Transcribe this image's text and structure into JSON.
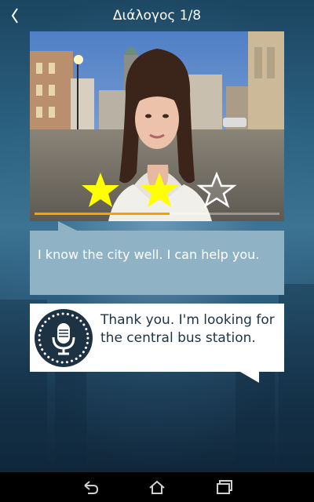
{
  "header": {
    "back_icon": "chevron-left-icon",
    "title": "Διάλογος 1/8"
  },
  "video": {
    "content": "woman-speaking-in-city-square",
    "progress_percent": 55
  },
  "rating": {
    "stars_filled": 2,
    "stars_total": 3,
    "filled_color": "#ffff00",
    "empty_color": "#ffffff"
  },
  "dialogue": {
    "speaker_line": "I know the city well. I can help you.",
    "user_line": "Thank you. I'm looking for the central bus station.",
    "mic_icon": "microphone-icon"
  },
  "nav": {
    "back_icon": "nav-back-icon",
    "home_icon": "nav-home-icon",
    "recents_icon": "nav-recents-icon"
  },
  "colors": {
    "accent_progress": "#f0a500",
    "speaker_bubble": "#8fb3c4",
    "user_text": "#1d3344"
  }
}
